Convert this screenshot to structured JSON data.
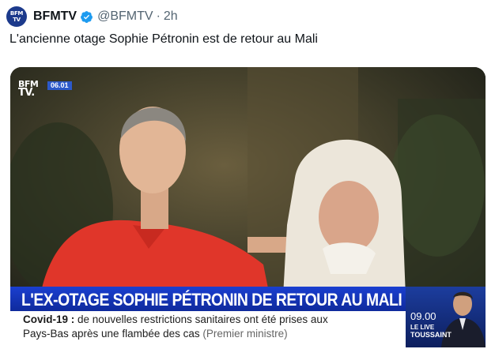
{
  "tweet": {
    "avatar_text_top": "BFM",
    "avatar_text_bottom": "TV",
    "display_name": "BFMTV",
    "verified_icon": "verified-badge-icon",
    "handle": "@BFMTV",
    "separator": "·",
    "time": "2h",
    "text": "L'ancienne otage Sophie Pétronin est de retour au Mali"
  },
  "media": {
    "logo_top": "BFM",
    "logo_bottom": "TV.",
    "clock": "06.01",
    "headline": "L'EX-OTAGE SOPHIE PÉTRONIN DE RETOUR AU MALI",
    "ticker_label": "Covid-19 :",
    "ticker_line1": "de nouvelles restrictions sanitaires ont été prises aux",
    "ticker_line2": "Pays-Bas après une flambée des cas",
    "ticker_source": "(Premier ministre)",
    "show_time": "09.00",
    "show_title_1": "LE LIVE",
    "show_title_2": "TOUSSAINT"
  },
  "colors": {
    "brand_blue": "#1c3a8c",
    "verified_blue": "#1d9bf0",
    "headline_blue": "#1a3fd0"
  }
}
